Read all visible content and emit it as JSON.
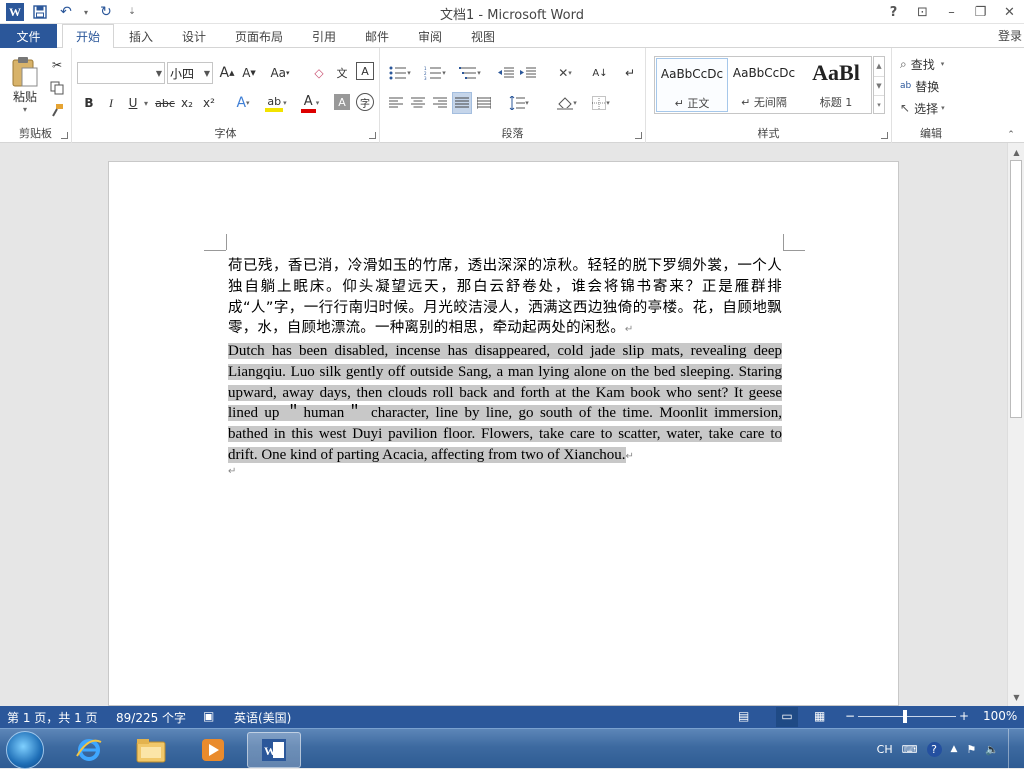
{
  "window": {
    "title": "文档1 - Microsoft Word",
    "help": "?",
    "restore_ribbon": "⊡",
    "minimize": "–",
    "maximize": "❐",
    "close": "✕",
    "qat_customize": "⇣"
  },
  "tabs": {
    "file": "文件",
    "items": [
      "开始",
      "插入",
      "设计",
      "页面布局",
      "引用",
      "邮件",
      "审阅",
      "视图"
    ],
    "active": "开始",
    "login": "登录"
  },
  "ribbon": {
    "clipboard": {
      "label": "剪贴板",
      "paste": "粘贴"
    },
    "font": {
      "label": "字体",
      "font_name": "",
      "font_size": "小四",
      "bold": "B",
      "italic": "I",
      "underline": "U",
      "strike": "abc",
      "sub": "x₂",
      "sup": "x²",
      "grow": "A",
      "shrink": "A",
      "case": "Aa"
    },
    "paragraph": {
      "label": "段落"
    },
    "styles": {
      "label": "样式",
      "items": [
        {
          "sample": "AaBbCcDc",
          "name": "↵ 正文"
        },
        {
          "sample": "AaBbCcDc",
          "name": "↵ 无间隔"
        },
        {
          "sample": "AaBl",
          "name": "标题 1"
        }
      ]
    },
    "editing": {
      "label": "编辑",
      "find": "查找",
      "replace": "替换",
      "select": "选择"
    }
  },
  "document": {
    "para_cn": "荷已残，香已消，冷滑如玉的竹席，透出深深的凉秋。轻轻的脱下罗绸外裳，一个人独自躺上眠床。仰头凝望远天，那白云舒卷处，谁会将锦书寄来？正是雁群排成“人”字，一行行南归时候。月光皎洁浸人，洒满这西边独倚的亭楼。花，自顾地飘零，水，自顾地漂流。一种离别的相思，牵动起两处的闲愁。",
    "para_en": "Dutch has been disabled, incense has disappeared, cold jade slip mats, revealing deep Liangqiu. Luo silk gently off outside Sang, a man lying alone on the bed sleeping. Staring upward, away days, then clouds roll back and forth at the Kam book who sent? It geese lined up ＂human＂ character, line by line, go south of the time. Moonlit immersion, bathed in this west Duyi pavilion floor. Flowers, take care to scatter, water, take care to drift. One kind of parting Acacia, affecting from two of Xianchou.",
    "para_mark": "↵"
  },
  "statusbar": {
    "page": "第 1 页，共 1 页",
    "words": "89/225 个字",
    "language": "英语(美国)",
    "zoom": "100%"
  },
  "taskbar": {
    "tray_lang": "CH"
  }
}
